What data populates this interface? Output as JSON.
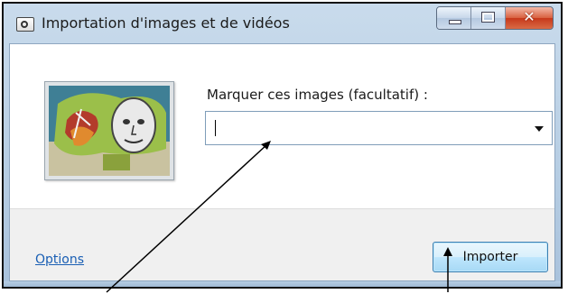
{
  "window": {
    "title": "Importation d'images et de vidéos"
  },
  "form": {
    "label": "Marquer ces images (facultatif) :",
    "input_value": "",
    "input_placeholder": ""
  },
  "footer": {
    "options_label": "Options",
    "import_label": "Importer"
  },
  "icons": {
    "title_icon": "camera-icon",
    "dropdown": "chevron-down-icon"
  },
  "colors": {
    "link": "#1a5fb4",
    "close_button": "#c7391b",
    "chrome": "#b6cde3"
  }
}
